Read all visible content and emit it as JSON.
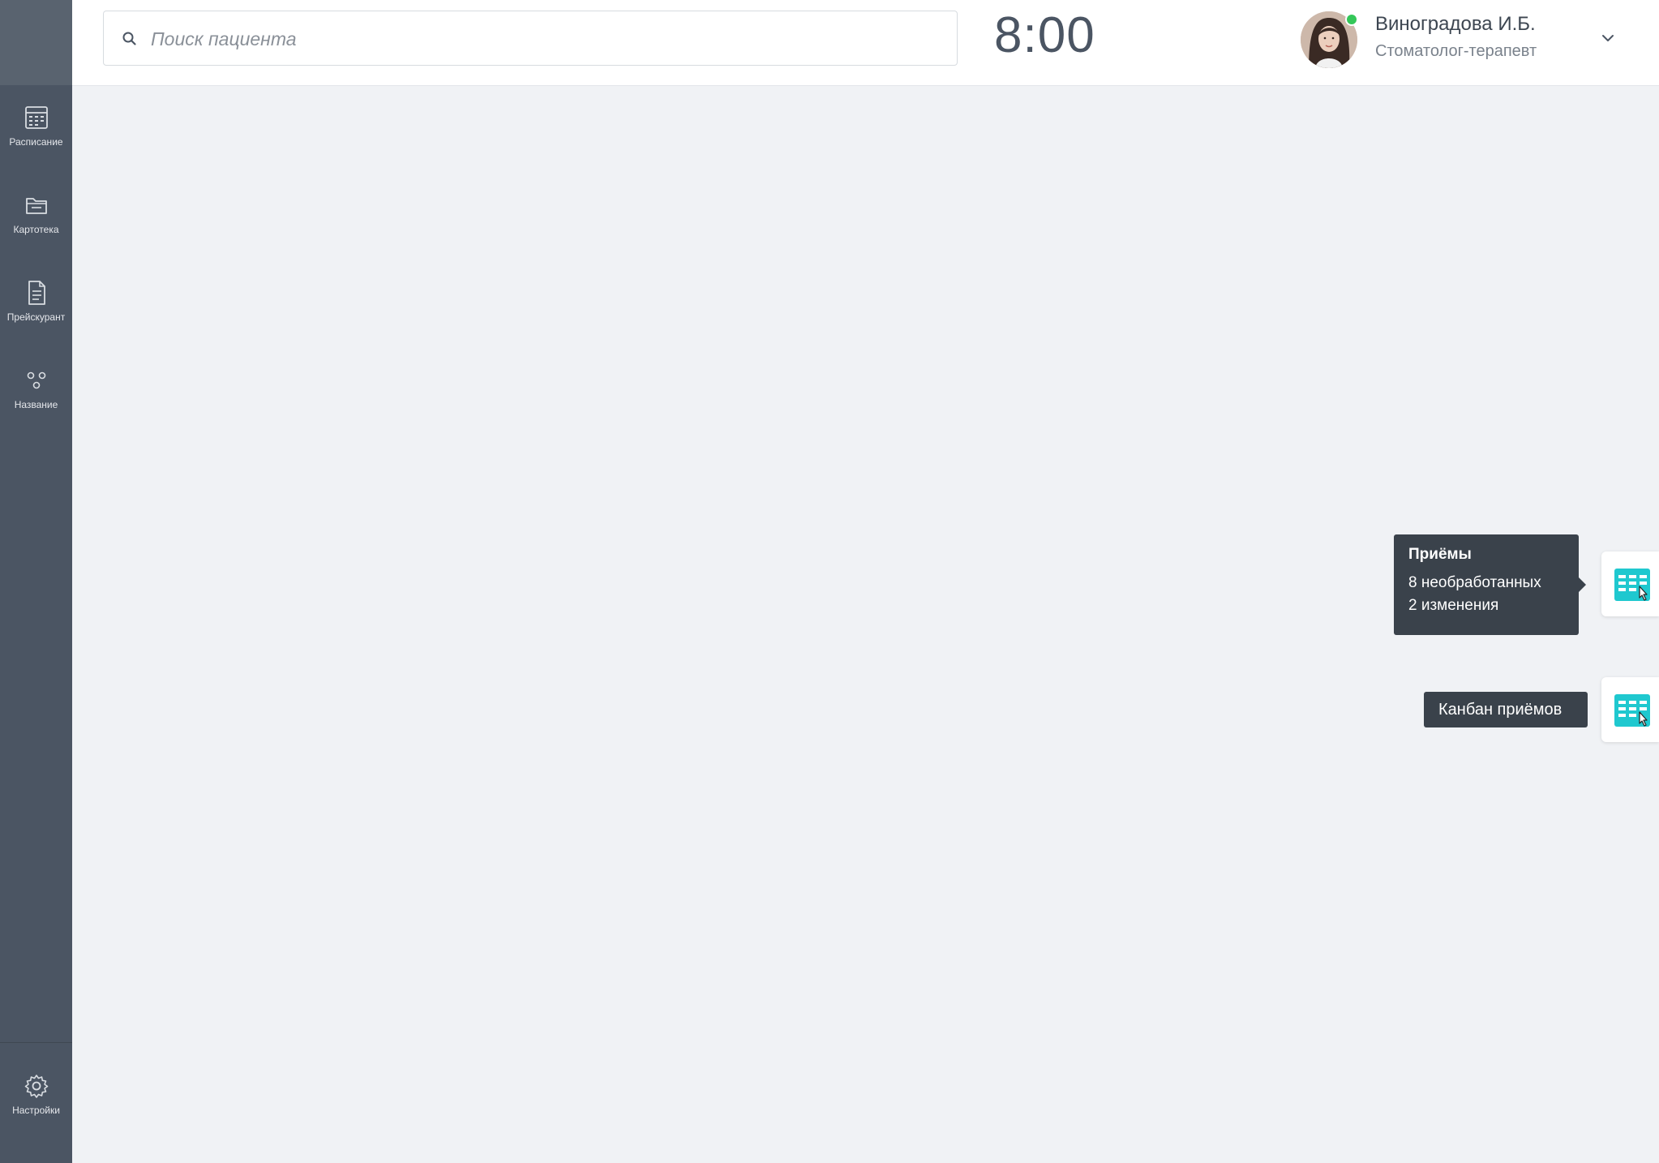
{
  "sidebar": {
    "items": [
      {
        "label": "Расписание",
        "icon": "calendar-icon"
      },
      {
        "label": "Картотека",
        "icon": "folder-icon"
      },
      {
        "label": "Прейскурант",
        "icon": "document-icon"
      },
      {
        "label": "Название",
        "icon": "dots-icon"
      }
    ],
    "settings": {
      "label": "Настройки",
      "icon": "gear-icon"
    }
  },
  "header": {
    "search_placeholder": "Поиск пациента",
    "time": "8:00",
    "user": {
      "name": "Виноградова И.Б.",
      "role": "Стоматолог-терапевт",
      "status_color": "#34c759"
    }
  },
  "floating": {
    "appointments_tooltip": {
      "title": "Приёмы",
      "line1": "8 необработанных",
      "line2": "2 изменения"
    },
    "kanban_tooltip": "Канбан приёмов",
    "accent_color": "#1fc8cf"
  }
}
